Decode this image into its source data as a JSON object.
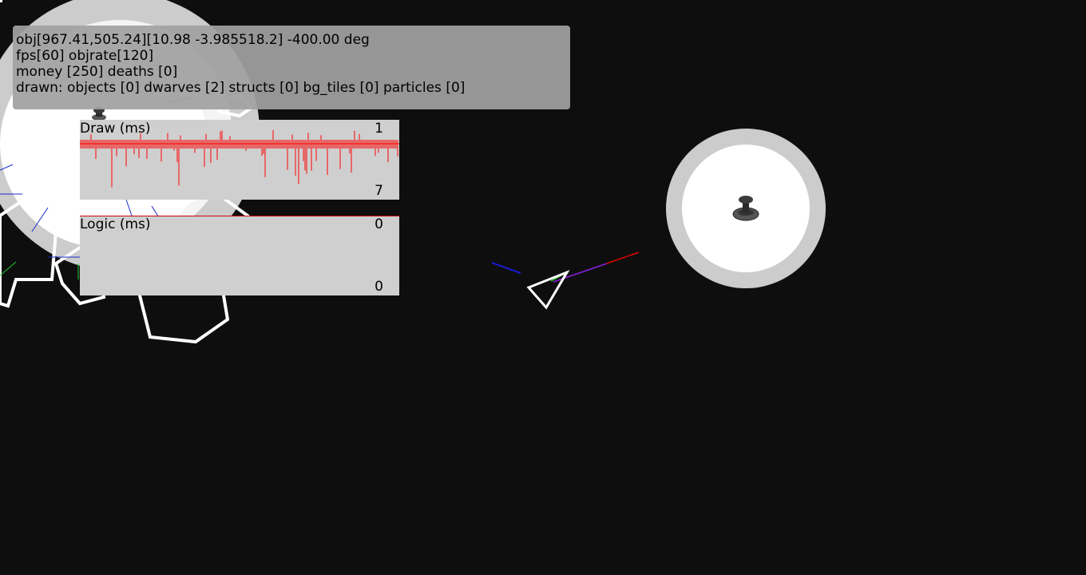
{
  "hud": {
    "line1": "obj[967.41,505.24][10.98 -3.985518.2] -400.00 deg",
    "line2": "fps[60] objrate[120]",
    "line3": "money [250] deaths [0]",
    "line4": "drawn: objects [0] dwarves [2] structs [0] bg_tiles [0] particles [0]"
  },
  "draw_graph": {
    "label": "Draw (ms)",
    "max": "1",
    "min": "7",
    "color": "#ff0000"
  },
  "logic_graph": {
    "label": "Logic (ms)",
    "max": "0",
    "min": "0",
    "color": "#cc0000"
  },
  "colors": {
    "background": "#0e0e0e",
    "planet_ring": "#cccccc",
    "planet_core": "#ffffff",
    "ship_outline": "#ffffff",
    "graph_line": "#ff0000"
  },
  "entities": {
    "planets": [
      "large-planet",
      "small-planet"
    ],
    "dwarves": [
      "dwarf-sprite-1",
      "dwarf-sprite-2"
    ],
    "ship": "player-ship"
  }
}
